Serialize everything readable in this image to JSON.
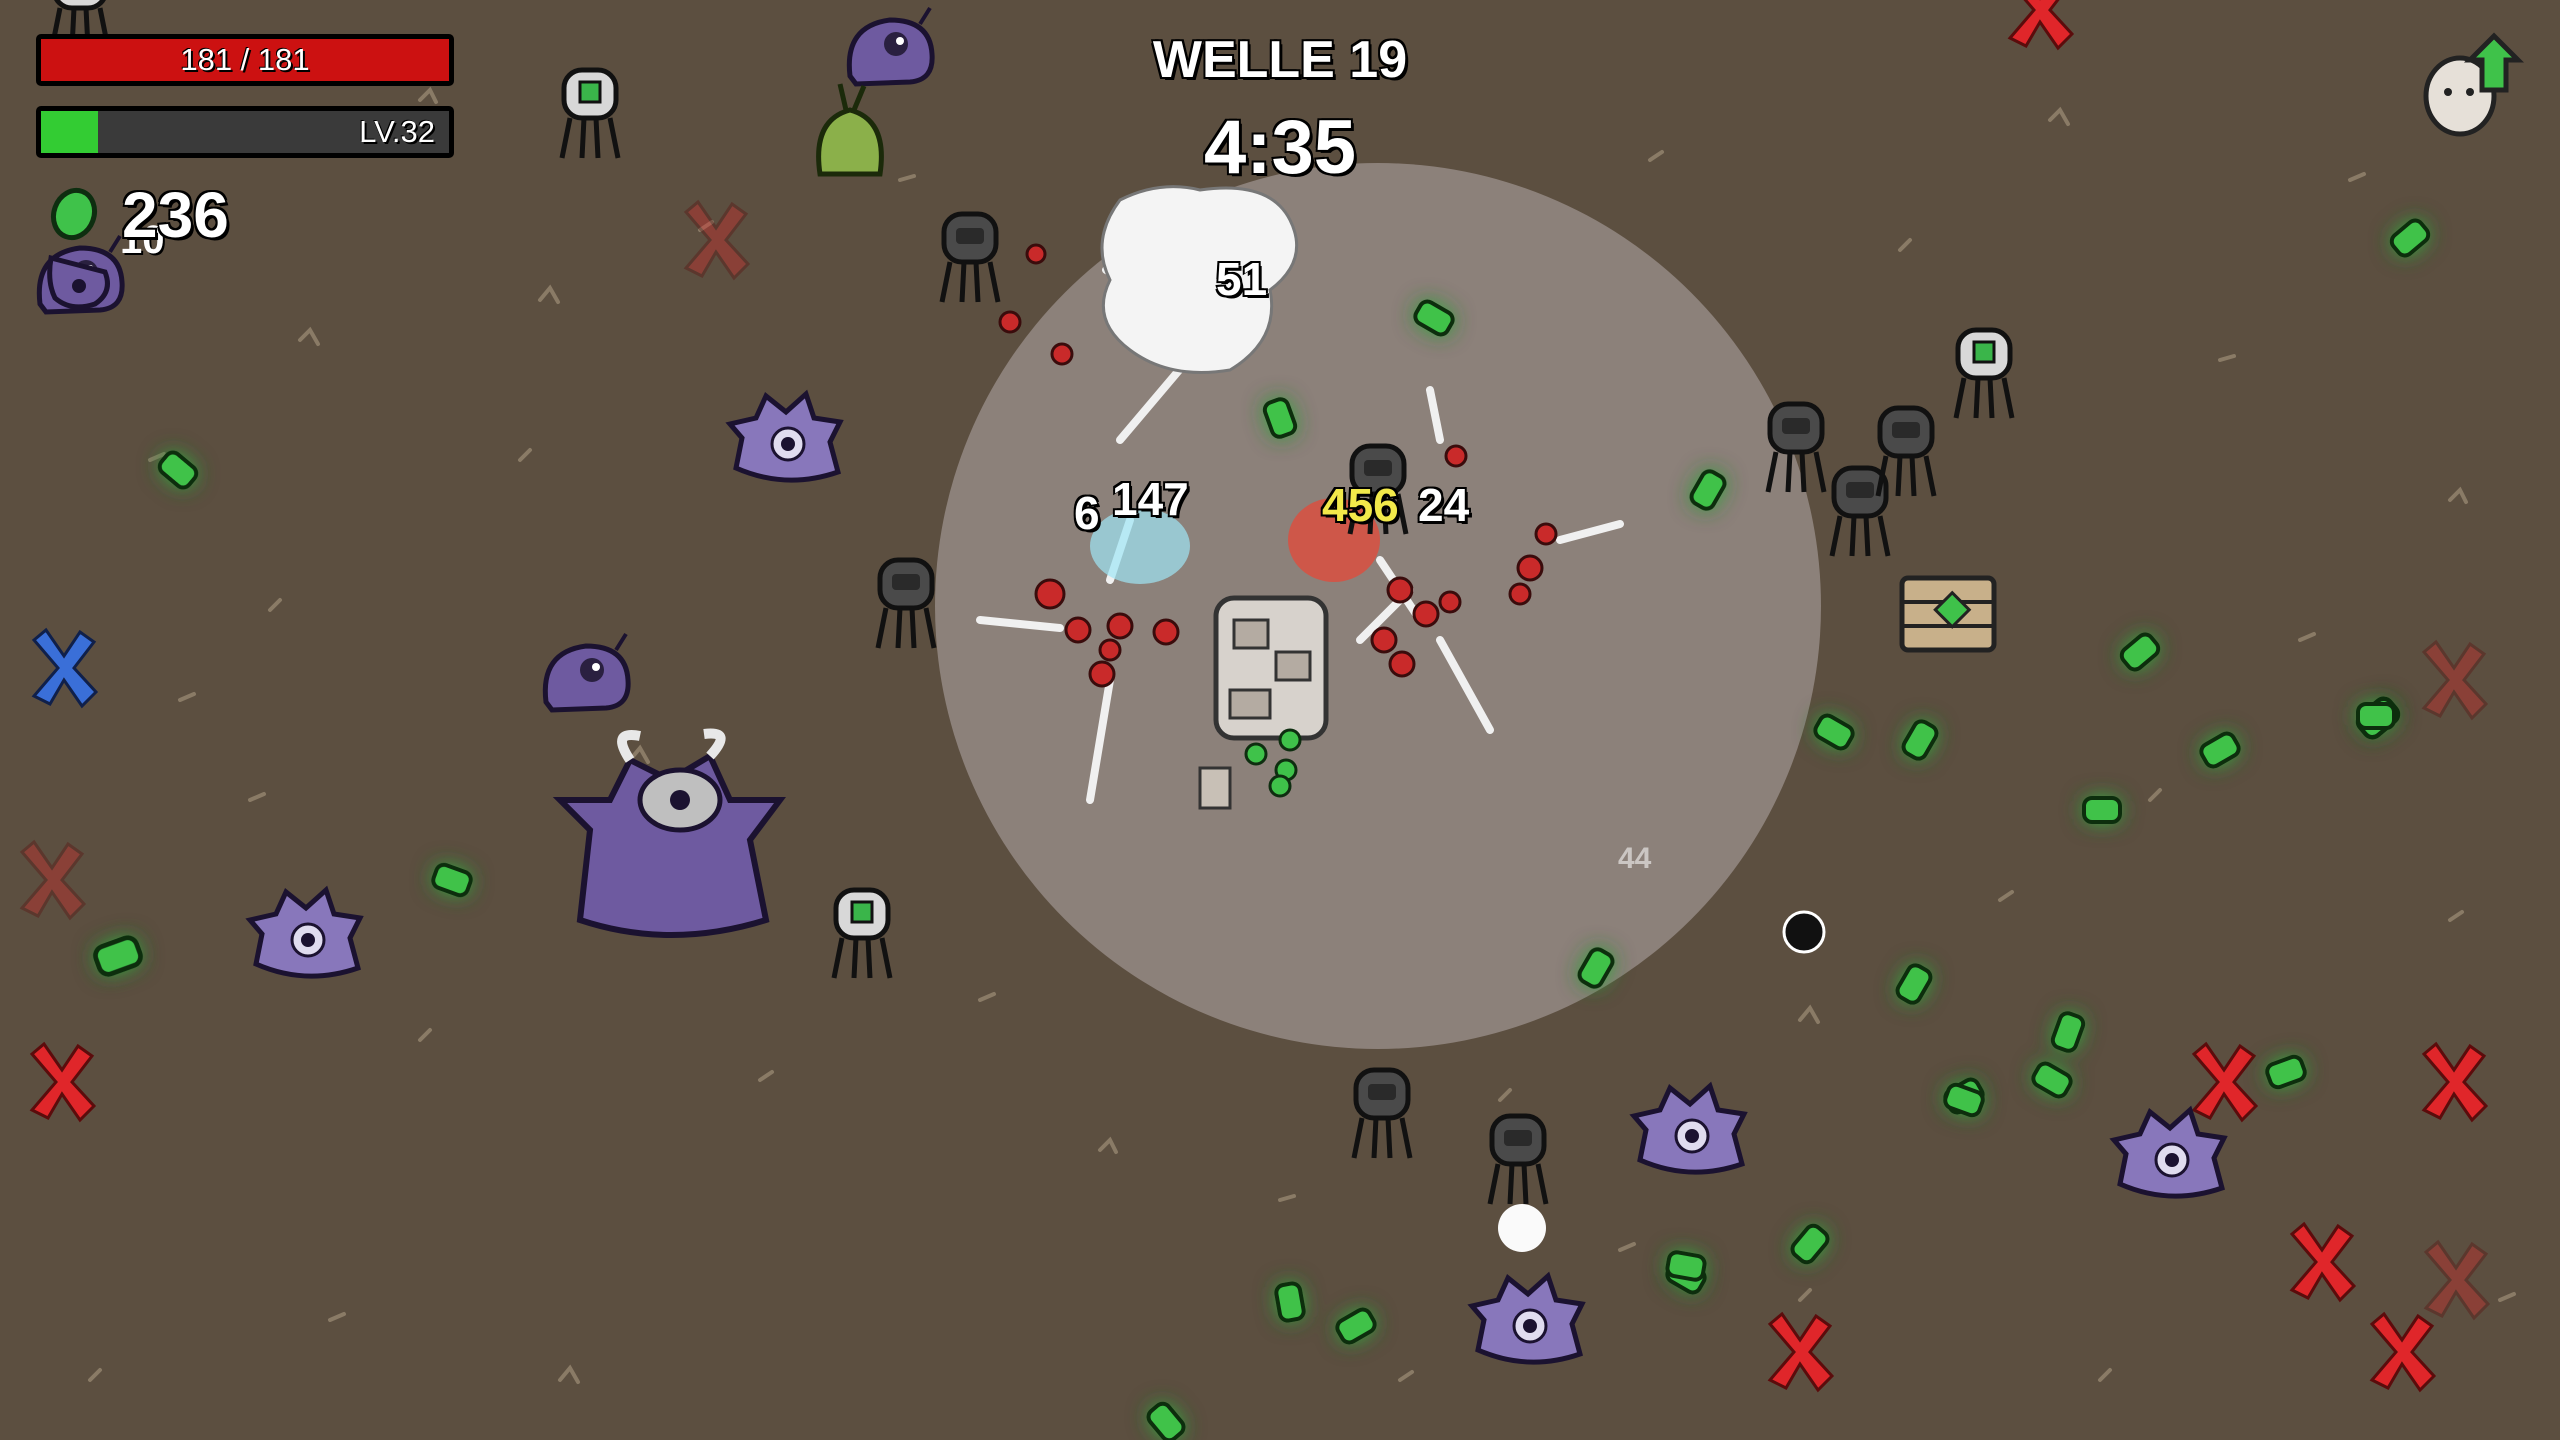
{
  "hud": {
    "hp_text": "181 / 181",
    "hp_fraction": 1.0,
    "level_text": "LV.32",
    "xp_fraction": 0.14,
    "materials_count": "236",
    "bag_count": "10"
  },
  "wave": {
    "label": "WELLE 19",
    "timer": "4:35"
  },
  "damage_numbers": {
    "d1": "51",
    "d2": "6",
    "d3": "147",
    "d4": "456",
    "d5": "24",
    "d6": "44"
  },
  "icons": {
    "materials": "green-material-icon",
    "bag": "purple-bag-icon",
    "levelup": "egg-levelup-arrow-icon"
  },
  "colors": {
    "hp": "#cc1111",
    "xp": "#33cc33",
    "crit": "#f2e94a",
    "enemy_purple": "#6e5aa0",
    "material_green": "#3fc24a"
  }
}
